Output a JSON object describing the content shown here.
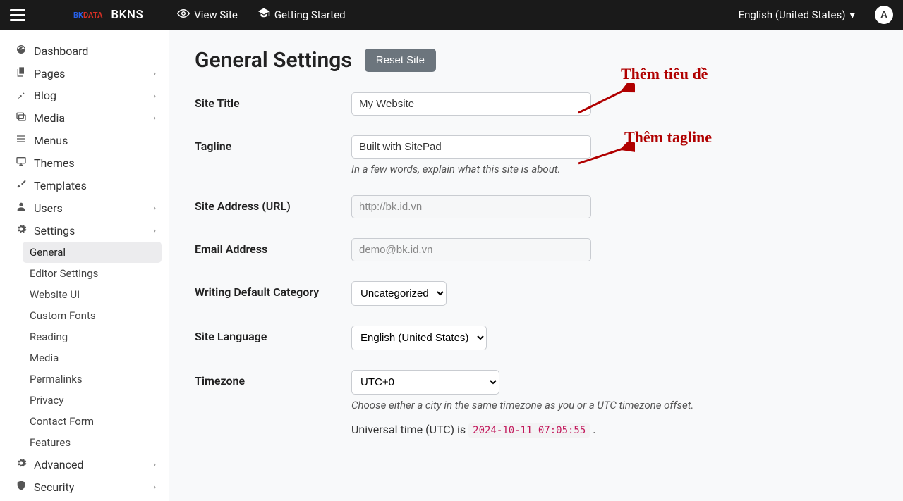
{
  "topbar": {
    "brand_small": "BKDATA",
    "brand": "BKNS",
    "view_site": "View Site",
    "getting_started": "Getting Started",
    "language": "English (United States)",
    "avatar_initial": "A"
  },
  "sidebar": {
    "items": [
      {
        "label": "Dashboard",
        "icon": "⏲",
        "expandable": false
      },
      {
        "label": "Pages",
        "icon": "📄",
        "expandable": true
      },
      {
        "label": "Blog",
        "icon": "📌",
        "expandable": true
      },
      {
        "label": "Media",
        "icon": "🖼",
        "expandable": true
      },
      {
        "label": "Menus",
        "icon": "☰",
        "expandable": false
      },
      {
        "label": "Themes",
        "icon": "🖥",
        "expandable": false
      },
      {
        "label": "Templates",
        "icon": "🖌",
        "expandable": false
      },
      {
        "label": "Users",
        "icon": "👤",
        "expandable": true
      },
      {
        "label": "Settings",
        "icon": "⚙",
        "expandable": true
      }
    ],
    "settings_sub": [
      "General",
      "Editor Settings",
      "Website UI",
      "Custom Fonts",
      "Reading",
      "Media",
      "Permalinks",
      "Privacy",
      "Contact Form",
      "Features"
    ],
    "bottom": [
      {
        "label": "Advanced",
        "icon": "⚙",
        "expandable": true
      },
      {
        "label": "Security",
        "icon": "🛡",
        "expandable": true
      }
    ]
  },
  "page": {
    "title": "General Settings",
    "reset_btn": "Reset Site",
    "fields": {
      "site_title_label": "Site Title",
      "site_title_value": "My Website",
      "tagline_label": "Tagline",
      "tagline_value": "Built with SitePad",
      "tagline_help": "In a few words, explain what this site is about.",
      "site_url_label": "Site Address (URL)",
      "site_url_value": "http://bk.id.vn",
      "email_label": "Email Address",
      "email_value": "demo@bk.id.vn",
      "writing_cat_label": "Writing Default Category",
      "writing_cat_value": "Uncategorized",
      "site_lang_label": "Site Language",
      "site_lang_value": "English (United States)",
      "timezone_label": "Timezone",
      "timezone_value": "UTC+0",
      "timezone_help": "Choose either a city in the same timezone as you or a UTC timezone offset.",
      "utc_prefix": "Universal time (UTC) is ",
      "utc_time": "2024-10-11 07:05:55",
      "utc_suffix": "."
    }
  },
  "annotations": {
    "title_note": "Thêm tiêu đề",
    "tagline_note": "Thêm tagline"
  }
}
